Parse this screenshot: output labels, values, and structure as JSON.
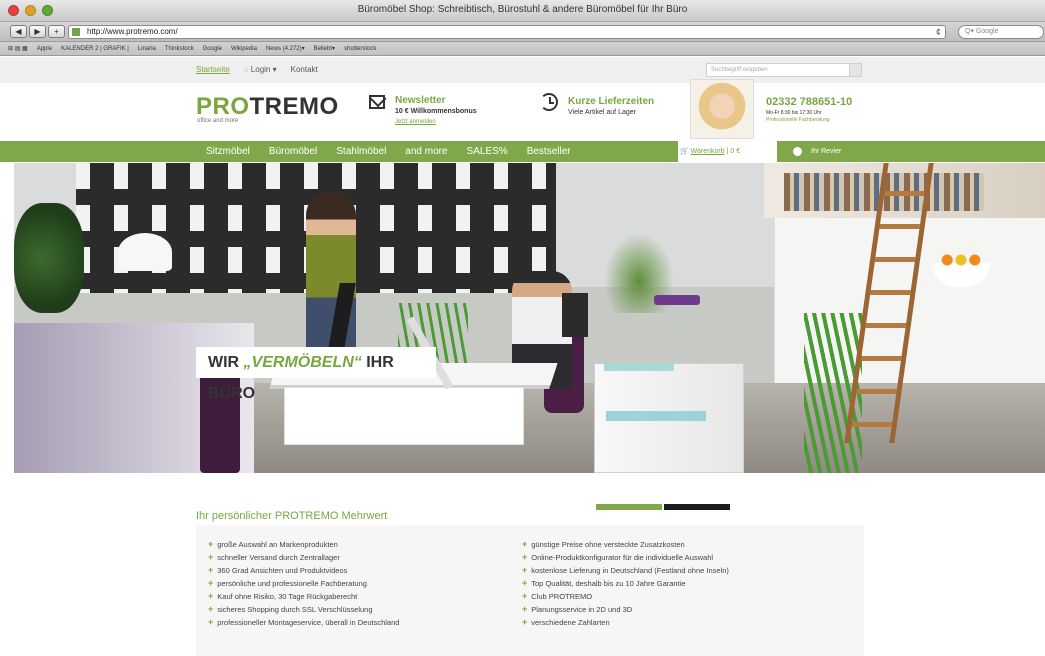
{
  "browser": {
    "window_title": "Büromöbel Shop: Schreibtisch, Bürostuhl & andere Büromöbel für Ihr Büro",
    "url": "http://www.protremo.com/",
    "search_placeholder": "Q▾ Google",
    "nav_back": "◀",
    "nav_forward": "▶",
    "nav_add": "+",
    "reload": "¢",
    "bookmarks": [
      "Apple",
      "KALENDER 2 | GRAFIK |",
      "Linaria",
      "Thinkstock",
      "Google",
      "Wikipedia",
      "News (4.272)▾",
      "Beliebt▾",
      "shutterstock"
    ]
  },
  "topbar": {
    "links": [
      "Startseite",
      "Login ▾",
      "Kontakt"
    ],
    "search_placeholder": "Suchbegriff eingeben"
  },
  "header": {
    "logo_pro": "PRO",
    "logo_rest": "TREMO",
    "logo_tagline": "office and more",
    "newsletter_title": "Newsletter",
    "newsletter_sub": "10 € Willkommensbonus",
    "newsletter_link": "Jetzt anmelden",
    "shipping_title": "Kurze Lieferzeiten",
    "shipping_sub": "Viele Artikel auf Lager",
    "phone": "02332 788651-10",
    "hours": "Mo-Fr 8:30 bis 17:30 Uhr",
    "hours_note": "Professionelle Fachberatung"
  },
  "nav": {
    "items": [
      "Sitzmöbel",
      "Büromöbel",
      "Stahlmöbel",
      "and more",
      "SALES%",
      "Bestseller"
    ],
    "cart_label": "Warenkorb",
    "cart_amount": "| 0 €",
    "merkzettel": "Ihr Revier"
  },
  "hero": {
    "caption_pre": "WIR ",
    "caption_highlight": "„VERMÖBELN“",
    "caption_post": " IHR BÜRO"
  },
  "benefits": {
    "title": "Ihr persönlicher PROTREMO Mehrwert",
    "left": [
      "große Auswahl an Markenprodukten",
      "schneller Versand durch Zentrallager",
      "360 Grad Ansichten und Produktvideos",
      "persönliche und professionelle Fachberatung",
      "Kauf ohne Risiko, 30 Tage Rückgaberecht",
      "sicheres Shopping durch SSL Verschlüsselung",
      "professioneller Montageservice, überall in Deutschland"
    ],
    "right": [
      "günstige Preise ohne versteckte Zusatzkosten",
      "Online-Produktkonfigurator für die individuelle Auswahl",
      "kostenlose Lieferung in Deutschland (Festland ohne Inseln)",
      "Top Qualität, deshalb bis zu 10 Jahre Garantie",
      "Club PROTREMO",
      "Planungsservice in 2D und 3D",
      "verschiedene Zahlarten"
    ]
  },
  "colors": {
    "brand_green": "#80a84b",
    "text_green": "#7aa640"
  }
}
